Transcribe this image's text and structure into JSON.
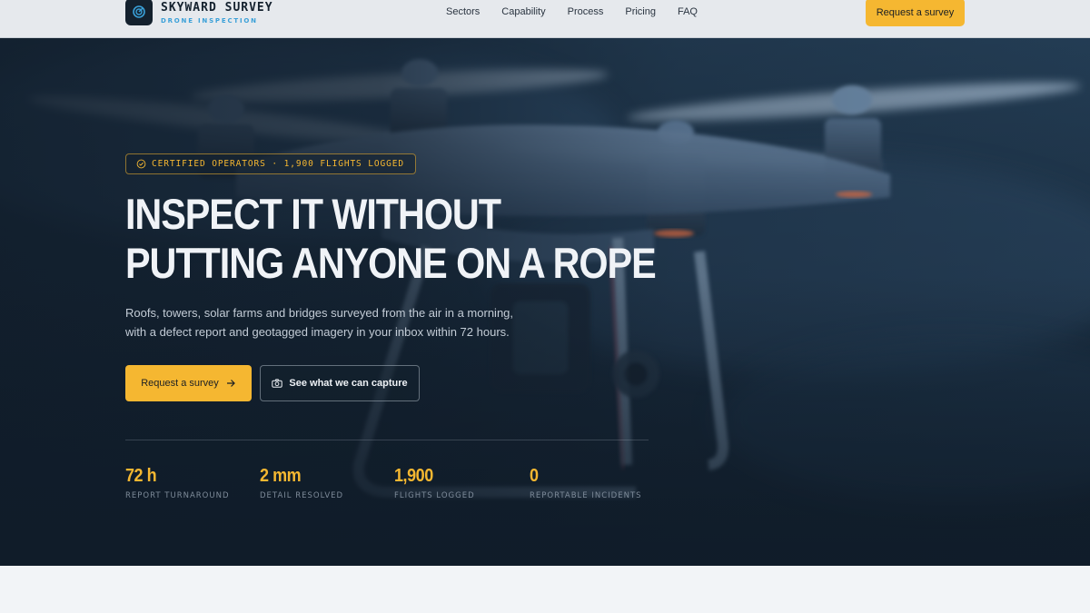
{
  "brand": {
    "name": "SKYWARD SURVEY",
    "tagline": "DRONE INSPECTION",
    "logo_icon": "radar-icon"
  },
  "nav": {
    "links": [
      "Sectors",
      "Capability",
      "Process",
      "Pricing",
      "FAQ"
    ],
    "cta_label": "Request a survey"
  },
  "hero": {
    "badge": {
      "icon": "check-circle-icon",
      "text": "CERTIFIED OPERATORS · 1,900 FLIGHTS LOGGED"
    },
    "headline_lines": [
      "INSPECT IT WITHOUT",
      "PUTTING ANYONE ON A ROPE"
    ],
    "subtext_lines": [
      "Roofs, towers, solar farms and bridges surveyed from the air in a morning,",
      "with a defect report and geotagged imagery in your inbox within 72 hours."
    ],
    "primary_button": {
      "label": "Request a survey",
      "icon": "arrow-right-icon"
    },
    "secondary_button": {
      "label": "See what we can capture",
      "icon": "camera-icon"
    },
    "background_image": "drone-photo"
  },
  "stats": [
    {
      "value": "72 h",
      "label": "REPORT TURNAROUND"
    },
    {
      "value": "2 mm",
      "label": "DETAIL RESOLVED"
    },
    {
      "value": "1,900",
      "label": "FLIGHTS LOGGED"
    },
    {
      "value": "0",
      "label": "REPORTABLE INCIDENTS"
    }
  ],
  "colors": {
    "accent": "#f5b731",
    "nav_background": "#e6e9ed",
    "hero_dark": "#14212e",
    "brand_sub": "#3aa0d8",
    "headline": "#f0f3f7"
  }
}
